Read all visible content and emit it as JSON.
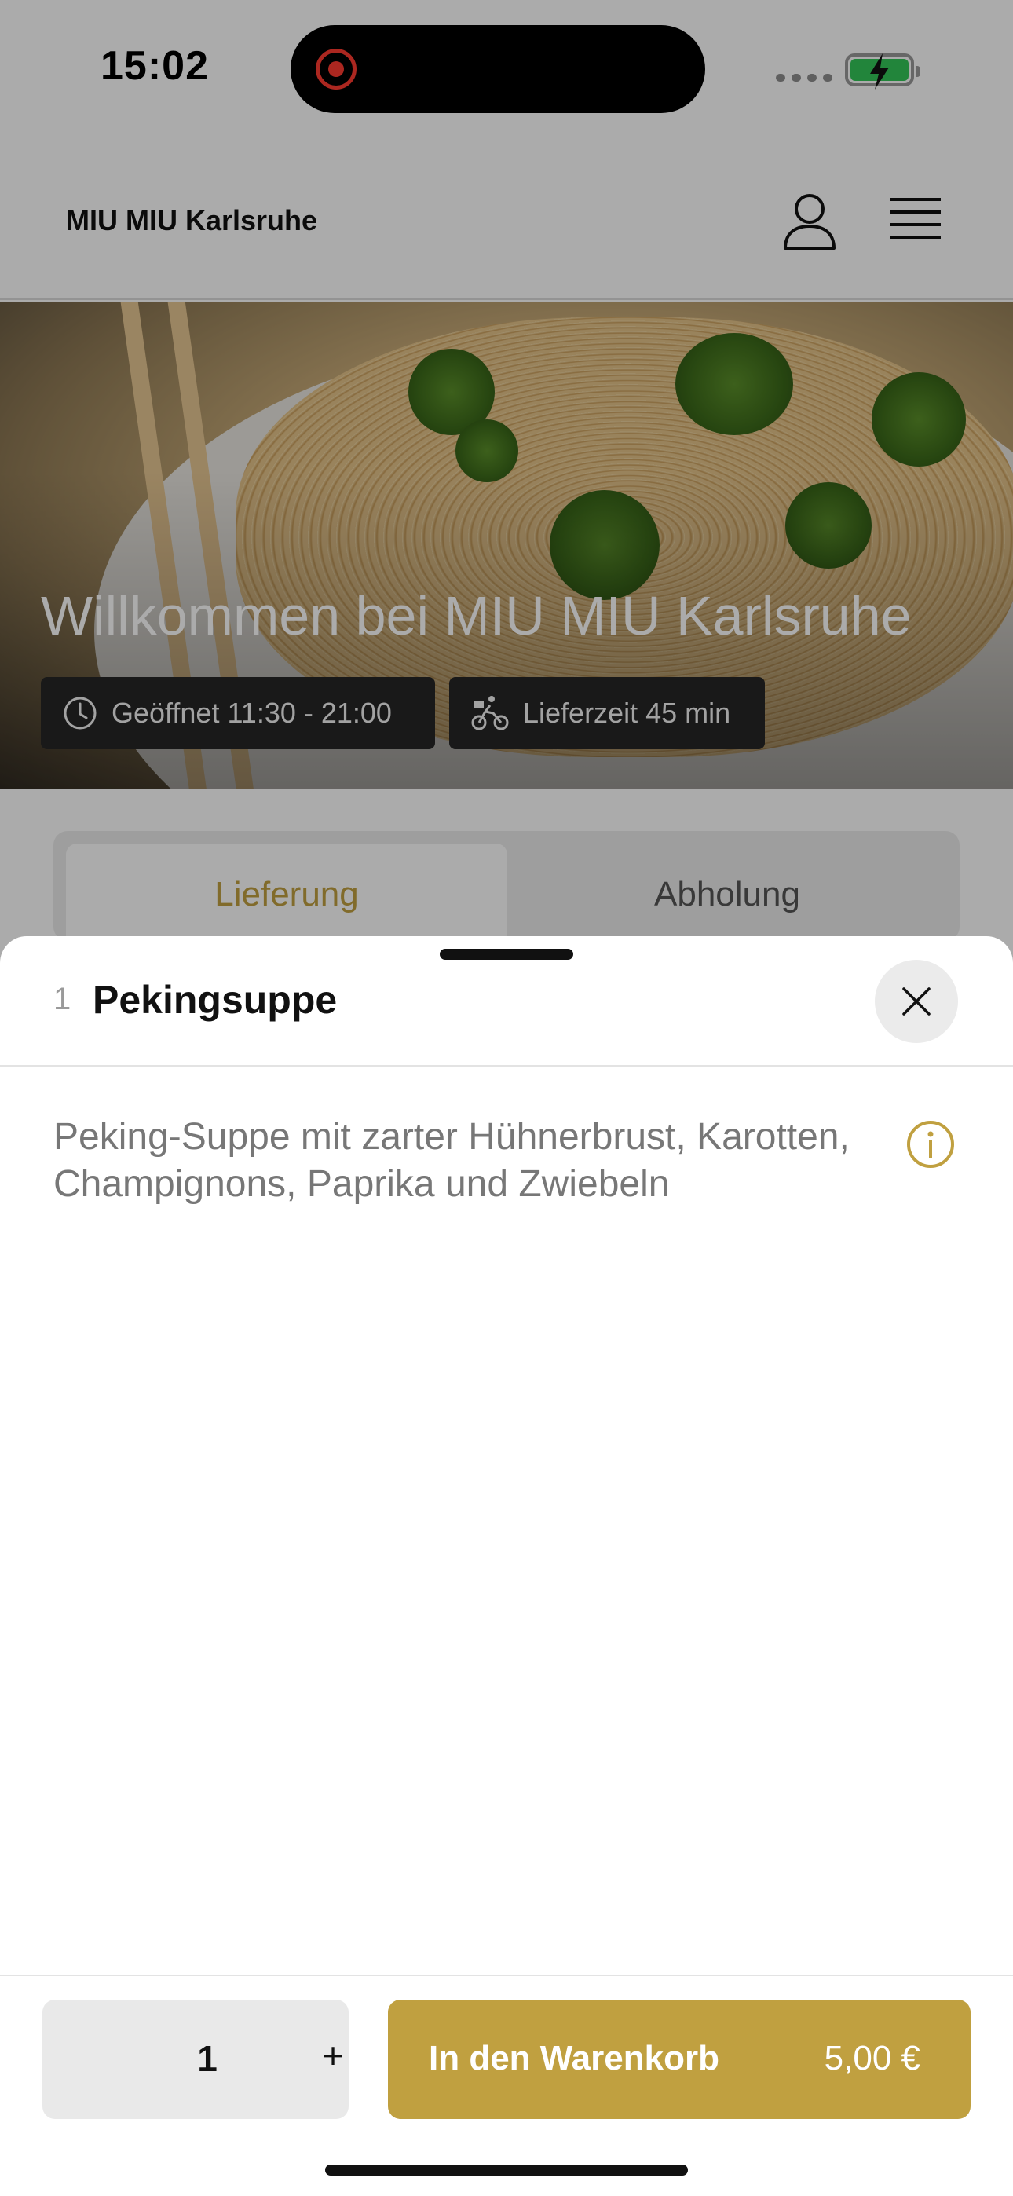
{
  "status_bar": {
    "time": "15:02"
  },
  "header": {
    "brand": "MIU MIU Karlsruhe"
  },
  "hero": {
    "title": "Willkommen bei MIU MIU Karlsruhe",
    "opening_hours": "Geöffnet 11:30 - 21:00",
    "delivery_time": "Lieferzeit 45 min"
  },
  "tabs": [
    {
      "label": "Lieferung",
      "active": true
    },
    {
      "label": "Abholung",
      "active": false
    }
  ],
  "sheet": {
    "item_number": "1",
    "item_title": "Pekingsuppe",
    "description": "Peking-Suppe mit zarter Hühnerbrust, Karotten, Champignons, Paprika und Zwiebeln"
  },
  "footer": {
    "quantity": "1",
    "plus_label": "+",
    "add_to_cart_label": "In den Warenkorb",
    "price": "5,00 €"
  },
  "colors": {
    "accent": "#c0a040",
    "chip_bg": "#262626"
  },
  "icons": [
    "user-icon",
    "menu-icon",
    "clock-icon",
    "bicycle-icon",
    "close-icon",
    "info-icon",
    "record-icon",
    "battery-icon"
  ]
}
